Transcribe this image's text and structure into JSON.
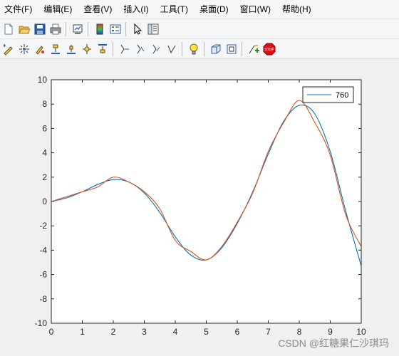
{
  "menubar": {
    "items": [
      "文件(F)",
      "编辑(E)",
      "查看(V)",
      "插入(I)",
      "工具(T)",
      "桌面(D)",
      "窗口(W)",
      "帮助(H)"
    ]
  },
  "toolbar1": {
    "icons": [
      "new-figure-icon",
      "open-file-icon",
      "save-icon",
      "print-icon",
      "link-plot-icon",
      "insert-colorbar-icon",
      "insert-legend-icon",
      "select-pointer-icon",
      "property-inspector-icon"
    ]
  },
  "toolbar2": {
    "icons": [
      "edit-plot-icon",
      "data-cursor-icon",
      "brush-icon",
      "align-left-icon",
      "align-center-icon",
      "align-distribute-icon",
      "align-top-icon",
      "curve-tool-1-icon",
      "curve-tool-2-icon",
      "curve-tool-3-icon",
      "curve-tool-4-icon",
      "lightbulb-icon",
      "3d-box-icon",
      "camera-icon",
      "run-icon",
      "stop-icon"
    ]
  },
  "watermark": "CSDN @红糖果仁沙琪玛",
  "colors": {
    "series1": "#0072bd",
    "series2": "#d95319",
    "axes_bg": "#ffffff",
    "figure_bg": "#f0f0f0"
  },
  "chart_data": {
    "type": "line",
    "title": "",
    "xlabel": "",
    "ylabel": "",
    "xlim": [
      0,
      10
    ],
    "ylim": [
      -10,
      10
    ],
    "xticks": [
      0,
      1,
      2,
      3,
      4,
      5,
      6,
      7,
      8,
      9,
      10
    ],
    "yticks": [
      -10,
      -8,
      -6,
      -4,
      -2,
      0,
      2,
      4,
      6,
      8,
      10
    ],
    "grid": false,
    "legend": {
      "position": "top-right",
      "entries": [
        "760"
      ]
    },
    "series": [
      {
        "name": "760",
        "color": "#0072bd",
        "x": [
          0,
          0.5,
          1,
          1.5,
          2,
          2.5,
          3,
          3.5,
          4,
          4.5,
          5,
          5.5,
          6,
          6.5,
          7,
          7.5,
          8,
          8.5,
          9,
          9.5,
          10
        ],
        "y": [
          0,
          0.3,
          0.8,
          1.4,
          1.8,
          1.6,
          0.7,
          -0.9,
          -2.9,
          -4.4,
          -4.8,
          -3.8,
          -1.8,
          0.8,
          3.9,
          6.6,
          7.9,
          7.2,
          4.1,
          -0.8,
          -5.3
        ]
      },
      {
        "name": "",
        "color": "#d95319",
        "x": [
          0,
          0.5,
          1,
          1.5,
          2,
          2.5,
          3,
          3.5,
          4,
          4.5,
          5,
          5.5,
          6,
          6.5,
          7,
          7.5,
          8,
          8.5,
          9,
          9.5,
          10
        ],
        "y": [
          0,
          0.4,
          0.8,
          1.2,
          2.0,
          1.6,
          0.8,
          -0.6,
          -3.2,
          -4.1,
          -4.8,
          -3.7,
          -1.7,
          0.7,
          4.1,
          6.5,
          8.3,
          6.5,
          3.8,
          -1.1,
          -3.7
        ]
      }
    ]
  }
}
